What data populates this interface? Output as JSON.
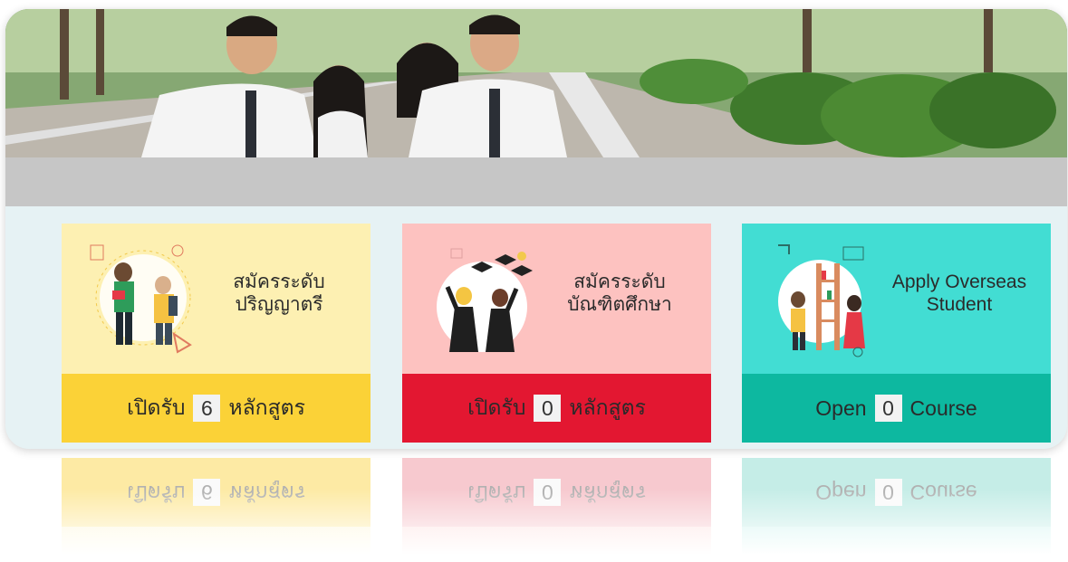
{
  "colors": {
    "undergrad_top": "#fdf0b2",
    "undergrad_bottom": "#fbd237",
    "graduate_top": "#fdc2c0",
    "graduate_bottom": "#e31731",
    "overseas_top": "#42ddd3",
    "overseas_bottom": "#0db8a0"
  },
  "hero": {
    "image": "students-hero-photo"
  },
  "cards": [
    {
      "title_line1": "สมัครระดับ",
      "title_line2": "ปริญญาตรี",
      "prefix": "เปิดรับ",
      "count": "6",
      "suffix": "หลักสูตร",
      "icon": "students-books-illustration"
    },
    {
      "title_line1": "สมัครระดับ",
      "title_line2": "บัณฑิตศึกษา",
      "prefix": "เปิดรับ",
      "count": "0",
      "suffix": "หลักสูตร",
      "icon": "graduates-caps-illustration"
    },
    {
      "title_line1": "Apply Overseas",
      "title_line2": "Student",
      "prefix": "Open",
      "count": "0",
      "suffix": "Course",
      "icon": "overseas-library-illustration"
    }
  ]
}
